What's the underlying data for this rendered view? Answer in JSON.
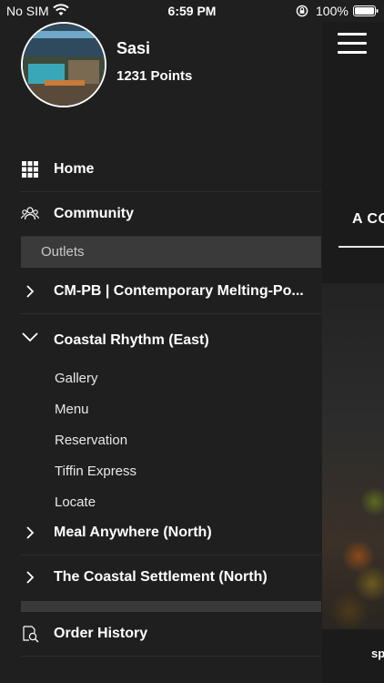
{
  "status_bar": {
    "carrier": "No SIM",
    "time": "6:59 PM",
    "battery": "100%"
  },
  "user": {
    "name": "Sasi",
    "points": "1231 Points"
  },
  "nav": {
    "home": "Home",
    "community": "Community",
    "outlets": "Outlets",
    "outlet_1": "CM-PB | Contemporary Melting-Po...",
    "outlet_2": "Coastal Rhythm (East)",
    "sub_items": [
      "Gallery",
      "Menu",
      "Reservation",
      "Tiffin Express",
      "Locate"
    ],
    "outlet_3": "Meal Anywhere (North)",
    "outlet_4": "The Coastal Settlement (North)",
    "order_history": "Order History"
  },
  "content": {
    "title_partial": "A CO",
    "bottom_text_partial": "sp"
  },
  "icons": {
    "home": "grid-icon",
    "community": "people-icon",
    "collapsed": "chevron-right-icon",
    "expanded": "chevron-down-icon",
    "order_history": "receipt-search-icon",
    "menu": "hamburger-icon"
  }
}
